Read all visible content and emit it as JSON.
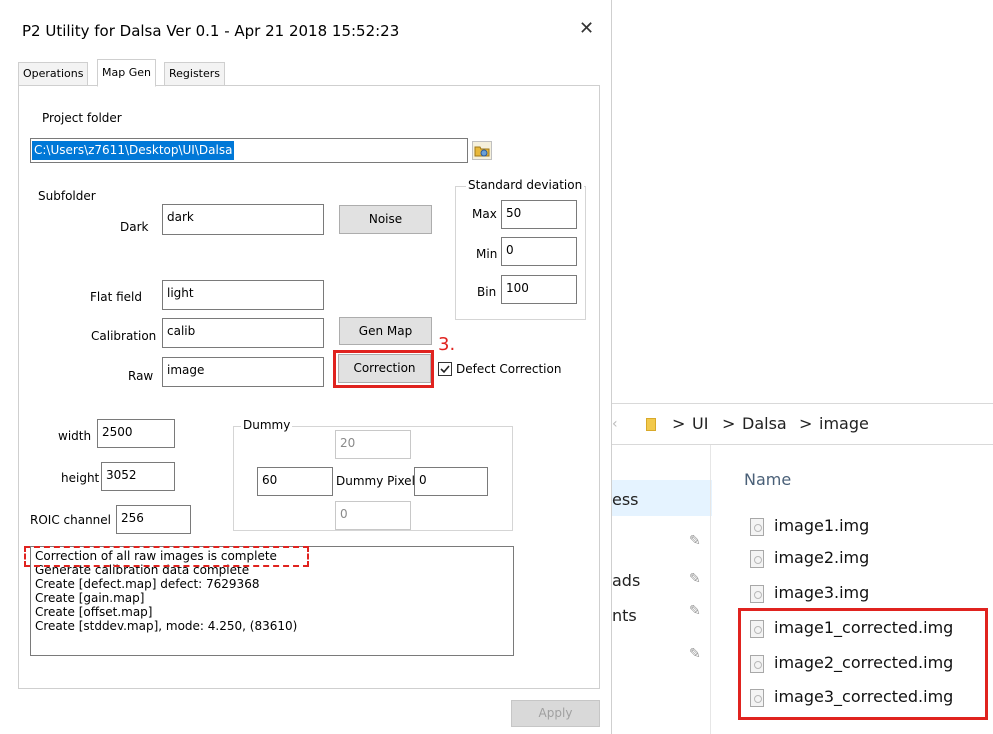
{
  "dialog": {
    "title": "P2 Utility for Dalsa Ver 0.1 - Apr 21 2018 15:52:23",
    "close_glyph": "✕",
    "tabs": [
      "Operations",
      "Map Gen",
      "Registers"
    ],
    "active_tab": "Map Gen",
    "project_folder_label": "Project folder",
    "project_folder_value": "C:\\Users\\z7611\\Desktop\\UI\\Dalsa",
    "subfolder_label": "Subfolder",
    "dark_label": "Dark",
    "dark_value": "dark",
    "flat_label": "Flat field",
    "flat_value": "light",
    "calibration_label": "Calibration",
    "calibration_value": "calib",
    "raw_label": "Raw",
    "raw_value": "image",
    "noise_button": "Noise",
    "genmap_button": "Gen Map",
    "correction_button": "Correction",
    "defect_correction_label": "Defect Correction",
    "defect_correction_checked": true,
    "std_dev": {
      "title": "Standard deviation",
      "max_label": "Max",
      "max_value": "50",
      "min_label": "Min",
      "min_value": "0",
      "bin_label": "Bin",
      "bin_value": "100"
    },
    "width_label": "width",
    "width_value": "2500",
    "height_label": "height",
    "height_value": "3052",
    "roic_label": "ROIC channel",
    "roic_value": "256",
    "dummy": {
      "title": "Dummy",
      "top_value": "20",
      "left_value": "60",
      "pixel_label": "Dummy Pixel",
      "pixel_value": "0",
      "bottom_value": "0"
    },
    "log_lines": [
      "Correction of all raw images is complete",
      "Generate calibration data complete",
      "Create [defect.map] defect: 7629368",
      "Create [gain.map]",
      "Create [offset.map]",
      "Create [stddev.map], mode: 4.250, (83610)"
    ],
    "apply_button": "Apply"
  },
  "annotation": {
    "step_label": "3.",
    "color": "#e0231f"
  },
  "explorer": {
    "breadcrumb": [
      "UI",
      "Dalsa",
      "image"
    ],
    "column_header": "Name",
    "nav_items": [
      "ess",
      "ads",
      "nts"
    ],
    "files": [
      "image1.img",
      "image2.img",
      "image3.img",
      "image1_corrected.img",
      "image2_corrected.img",
      "image3_corrected.img"
    ]
  }
}
